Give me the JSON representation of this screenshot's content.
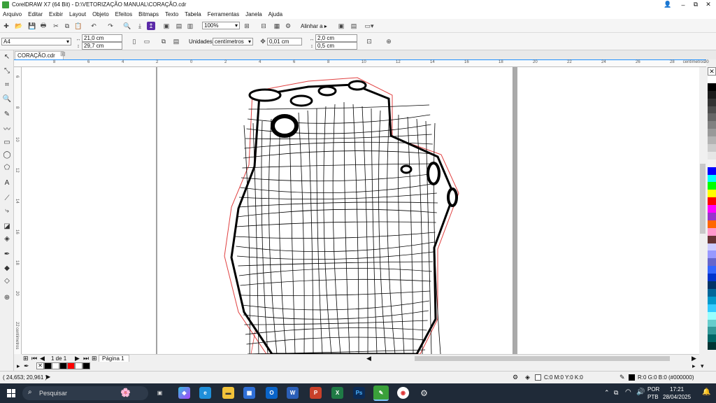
{
  "window": {
    "title": "CorelDRAW X7 (64 Bit) - D:\\VETORIZAÇÃO MANUAL\\CORAÇÃO.cdr",
    "min_glyph": "–",
    "max_glyph": "⧉",
    "close_glyph": "✕"
  },
  "menu": [
    "Arquivo",
    "Editar",
    "Exibir",
    "Layout",
    "Objeto",
    "Efeitos",
    "Bitmaps",
    "Texto",
    "Tabela",
    "Ferramentas",
    "Janela",
    "Ajuda"
  ],
  "toolbar1": {
    "zoom": "100%",
    "align_label": "Alinhar a"
  },
  "property_bar": {
    "paper_size": "A4",
    "width": "21,0 cm",
    "height": "29,7 cm",
    "units_label": "Unidades:",
    "units_value": "centímetros",
    "nudge": "0,01 cm",
    "dup_x": "2,0 cm",
    "dup_y": "0,5 cm"
  },
  "document_tab": "CORAÇÃO.cdr",
  "ruler": {
    "h_ticks": [
      "8",
      "6",
      "4",
      "2",
      "0",
      "2",
      "4",
      "6",
      "8",
      "10",
      "12",
      "14",
      "16",
      "18",
      "20",
      "22",
      "24",
      "26",
      "28",
      "30"
    ],
    "h_unit": "centímetros",
    "v_ticks": [
      "6",
      "8",
      "10",
      "12",
      "14",
      "16",
      "18",
      "20",
      "22"
    ],
    "v_unit": "centímetros"
  },
  "page_nav": {
    "count": "1 de 1",
    "page_label": "Página 1"
  },
  "palette_colors": [
    "#ffffff",
    "#000000",
    "#1a1a1a",
    "#333333",
    "#4d4d4d",
    "#666666",
    "#808080",
    "#999999",
    "#b3b3b3",
    "#cccccc",
    "#e6e6e6",
    "#f2f2f2",
    "#0000ff",
    "#00ffff",
    "#00ff00",
    "#ffff00",
    "#ff0000",
    "#ff00ff",
    "#9933cc",
    "#ff6600",
    "#ff99cc",
    "#663333",
    "#ccccff",
    "#9999ff",
    "#6666cc",
    "#3366ff",
    "#0033cc",
    "#003366",
    "#006699",
    "#0099cc",
    "#33ccff",
    "#99ffff",
    "#66cccc",
    "#339999",
    "#006666",
    "#003333"
  ],
  "doc_palette_colors": [
    "#ffffff",
    "#000000",
    "#ffffff",
    "#000000",
    "#ff0000",
    "#ffffff",
    "#000000"
  ],
  "status": {
    "coordinates": "( 24,653; 20,961 )",
    "fill": "C:0 M:0 Y:0 K:0",
    "outline": "R:0 G:0 B:0 (#000000)"
  },
  "taskbar": {
    "search_placeholder": "Pesquisar",
    "lang1": "POR",
    "lang2": "PTB",
    "time": "17:21",
    "date": "28/04/2025"
  }
}
